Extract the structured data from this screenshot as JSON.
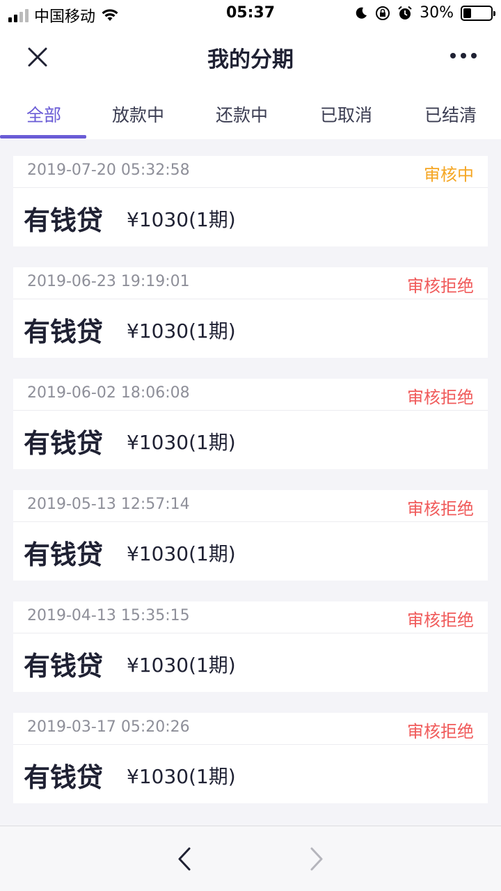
{
  "status_bar": {
    "carrier": "中国移动",
    "time": "05:37",
    "battery": "30%",
    "battery_level": 0.3,
    "icons": [
      "signal-icon",
      "wifi-icon",
      "moon-icon",
      "orientation-lock-icon",
      "alarm-icon",
      "battery-icon"
    ]
  },
  "nav": {
    "title": "我的分期",
    "close_icon": "close-icon",
    "more_icon": "more-icon"
  },
  "tabs": [
    {
      "label": "全部",
      "active": true
    },
    {
      "label": "放款中",
      "active": false
    },
    {
      "label": "还款中",
      "active": false
    },
    {
      "label": "已取消",
      "active": false
    },
    {
      "label": "已结清",
      "active": false
    }
  ],
  "colors": {
    "accent": "#6a5cd6",
    "status_pending": "#f5a623",
    "status_rejected": "#f05a5a"
  },
  "orders": [
    {
      "date": "2019-07-20 05:32:58",
      "status": "审核中",
      "status_type": "pending",
      "product": "有钱贷",
      "amount": "¥1030(1期)"
    },
    {
      "date": "2019-06-23 19:19:01",
      "status": "审核拒绝",
      "status_type": "rejected",
      "product": "有钱贷",
      "amount": "¥1030(1期)"
    },
    {
      "date": "2019-06-02 18:06:08",
      "status": "审核拒绝",
      "status_type": "rejected",
      "product": "有钱贷",
      "amount": "¥1030(1期)"
    },
    {
      "date": "2019-05-13 12:57:14",
      "status": "审核拒绝",
      "status_type": "rejected",
      "product": "有钱贷",
      "amount": "¥1030(1期)"
    },
    {
      "date": "2019-04-13 15:35:15",
      "status": "审核拒绝",
      "status_type": "rejected",
      "product": "有钱贷",
      "amount": "¥1030(1期)"
    },
    {
      "date": "2019-03-17 05:20:26",
      "status": "审核拒绝",
      "status_type": "rejected",
      "product": "有钱贷",
      "amount": "¥1030(1期)"
    }
  ],
  "bottom_bar": {
    "back_icon": "chevron-left-icon",
    "forward_icon": "chevron-right-icon"
  }
}
